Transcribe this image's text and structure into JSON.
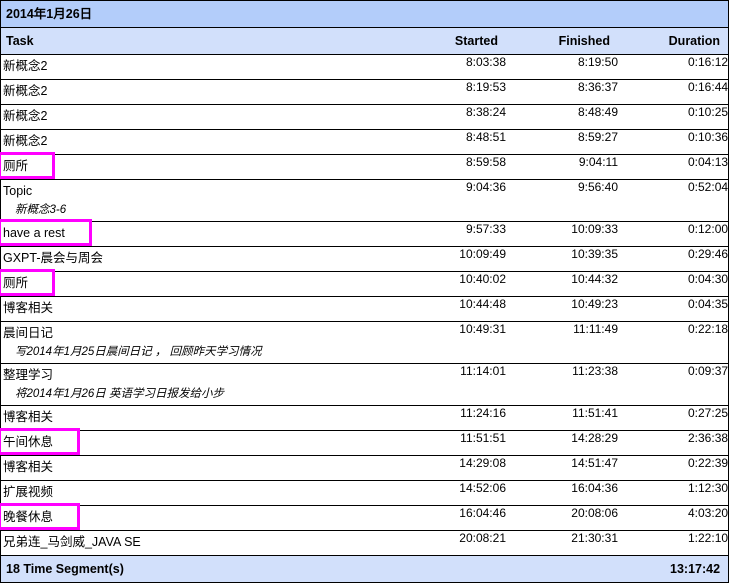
{
  "report": {
    "title": "2014年1月26日",
    "columns": {
      "task": "Task",
      "started": "Started",
      "finished": "Finished",
      "duration": "Duration"
    },
    "highlight_color": "#ff00ff",
    "title_bar_color": "#b3cdfa",
    "header_color": "#d2e0fb",
    "rows": [
      {
        "task": "新概念2",
        "note": "",
        "marked": false,
        "started": "8:03:38",
        "finished": "8:19:50",
        "duration": "0:16:12"
      },
      {
        "task": "新概念2",
        "note": "",
        "marked": false,
        "started": "8:19:53",
        "finished": "8:36:37",
        "duration": "0:16:44"
      },
      {
        "task": "新概念2",
        "note": "",
        "marked": false,
        "started": "8:38:24",
        "finished": "8:48:49",
        "duration": "0:10:25"
      },
      {
        "task": "新概念2",
        "note": "",
        "marked": false,
        "started": "8:48:51",
        "finished": "8:59:27",
        "duration": "0:10:36"
      },
      {
        "task": "厕所",
        "note": "",
        "marked": true,
        "started": "8:59:58",
        "finished": "9:04:11",
        "duration": "0:04:13"
      },
      {
        "task": "Topic",
        "note": "新概念3-6",
        "marked": false,
        "started": "9:04:36",
        "finished": "9:56:40",
        "duration": "0:52:04"
      },
      {
        "task": "have a rest",
        "note": "",
        "marked": true,
        "started": "9:57:33",
        "finished": "10:09:33",
        "duration": "0:12:00"
      },
      {
        "task": "GXPT-晨会与周会",
        "note": "",
        "marked": false,
        "started": "10:09:49",
        "finished": "10:39:35",
        "duration": "0:29:46"
      },
      {
        "task": "厕所",
        "note": "",
        "marked": true,
        "started": "10:40:02",
        "finished": "10:44:32",
        "duration": "0:04:30"
      },
      {
        "task": "博客相关",
        "note": "",
        "marked": false,
        "started": "10:44:48",
        "finished": "10:49:23",
        "duration": "0:04:35"
      },
      {
        "task": "晨间日记",
        "note": "写2014年1月25日晨间日记 ， 回顾昨天学习情况",
        "marked": false,
        "started": "10:49:31",
        "finished": "11:11:49",
        "duration": "0:22:18"
      },
      {
        "task": "整理学习",
        "note": "将2014年1月26日 英语学习日报发给小步",
        "marked": false,
        "started": "11:14:01",
        "finished": "11:23:38",
        "duration": "0:09:37"
      },
      {
        "task": "博客相关",
        "note": "",
        "marked": false,
        "started": "11:24:16",
        "finished": "11:51:41",
        "duration": "0:27:25"
      },
      {
        "task": "午间休息",
        "note": "",
        "marked": true,
        "started": "11:51:51",
        "finished": "14:28:29",
        "duration": "2:36:38"
      },
      {
        "task": "博客相关",
        "note": "",
        "marked": false,
        "started": "14:29:08",
        "finished": "14:51:47",
        "duration": "0:22:39"
      },
      {
        "task": "扩展视频",
        "note": "",
        "marked": false,
        "started": "14:52:06",
        "finished": "16:04:36",
        "duration": "1:12:30"
      },
      {
        "task": "晚餐休息",
        "note": "",
        "marked": true,
        "started": "16:04:46",
        "finished": "20:08:06",
        "duration": "4:03:20"
      },
      {
        "task": "兄弟连_马剑威_JAVA SE",
        "note": "",
        "marked": false,
        "started": "20:08:21",
        "finished": "21:30:31",
        "duration": "1:22:10"
      }
    ],
    "footer": {
      "summary": "18 Time Segment(s)",
      "total": "13:17:42"
    }
  }
}
